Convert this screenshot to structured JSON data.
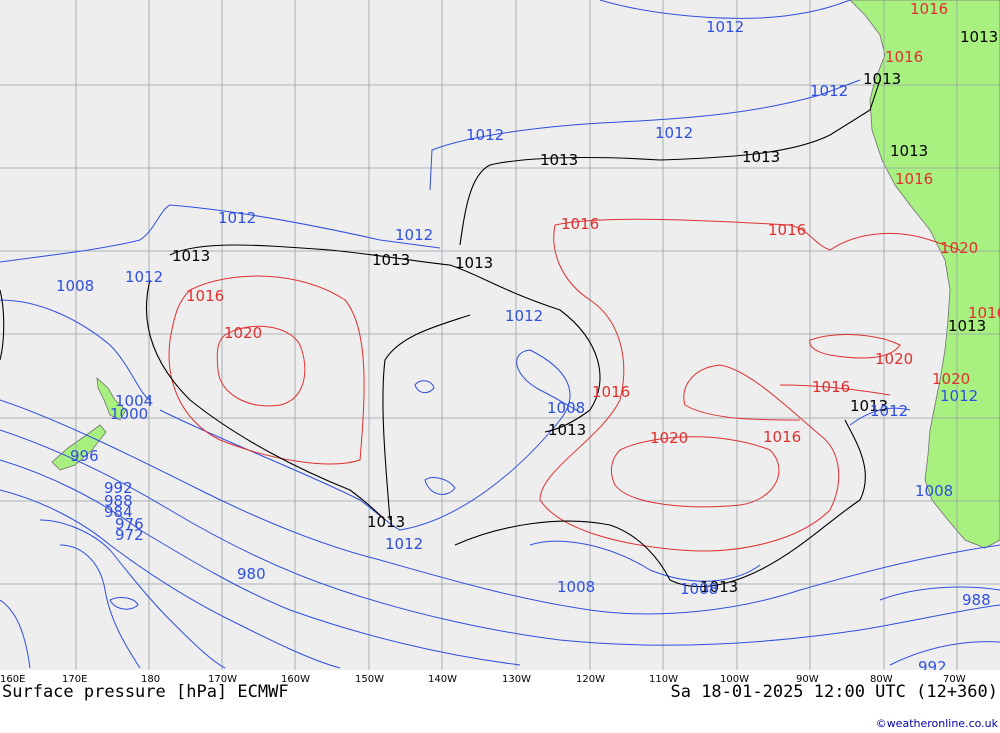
{
  "footer": {
    "title": "Surface pressure [hPa] ECMWF",
    "datetime": "Sa 18-01-2025 12:00 UTC (12+360)",
    "credit": "©weatheronline.co.uk"
  },
  "axis": {
    "lon_labels": [
      "160E",
      "170E",
      "180",
      "170W",
      "160W",
      "150W",
      "140W",
      "130W",
      "120W",
      "110W",
      "100W",
      "90W",
      "80W",
      "70W"
    ]
  },
  "colors": {
    "ocean": "#eeeeee",
    "land": "#a8f080",
    "grid": "#9aa0a8",
    "isobar_low": "#2f4fe0",
    "isobar_high": "#e03030",
    "isobar_1013": "#000000"
  },
  "isobar_labels": {
    "black": [
      "1013",
      "1013",
      "1013",
      "1013",
      "1013",
      "1013",
      "1013",
      "1013",
      "1013",
      "1013",
      "1013",
      "1013",
      "1013"
    ],
    "blue": [
      "1012",
      "1012",
      "1012",
      "1012",
      "1012",
      "1012",
      "1012",
      "1012",
      "1012",
      "1012",
      "1008",
      "1008",
      "1008",
      "1008",
      "1008",
      "1004",
      "1000",
      "996",
      "992",
      "988",
      "984",
      "976",
      "972",
      "980",
      "988",
      "992",
      "1012"
    ],
    "red": [
      "1016",
      "1016",
      "1016",
      "1016",
      "1016",
      "1016",
      "1016",
      "1016",
      "1016",
      "1020",
      "1020",
      "1020",
      "1020",
      "1020",
      "1016"
    ]
  }
}
